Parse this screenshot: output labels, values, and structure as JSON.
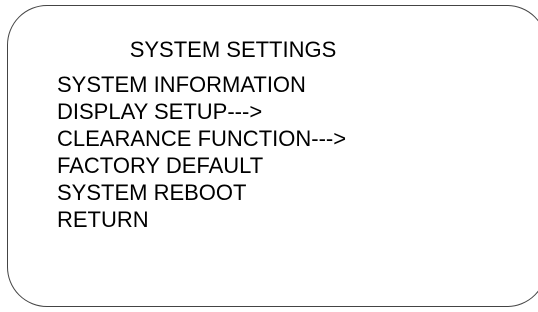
{
  "menu": {
    "title": "SYSTEM SETTINGS",
    "items": [
      {
        "label": "SYSTEM INFORMATION"
      },
      {
        "label": "DISPLAY SETUP--->"
      },
      {
        "label": "CLEARANCE FUNCTION--->"
      },
      {
        "label": "FACTORY DEFAULT"
      },
      {
        "label": "SYSTEM REBOOT"
      },
      {
        "label": "RETURN"
      }
    ]
  }
}
